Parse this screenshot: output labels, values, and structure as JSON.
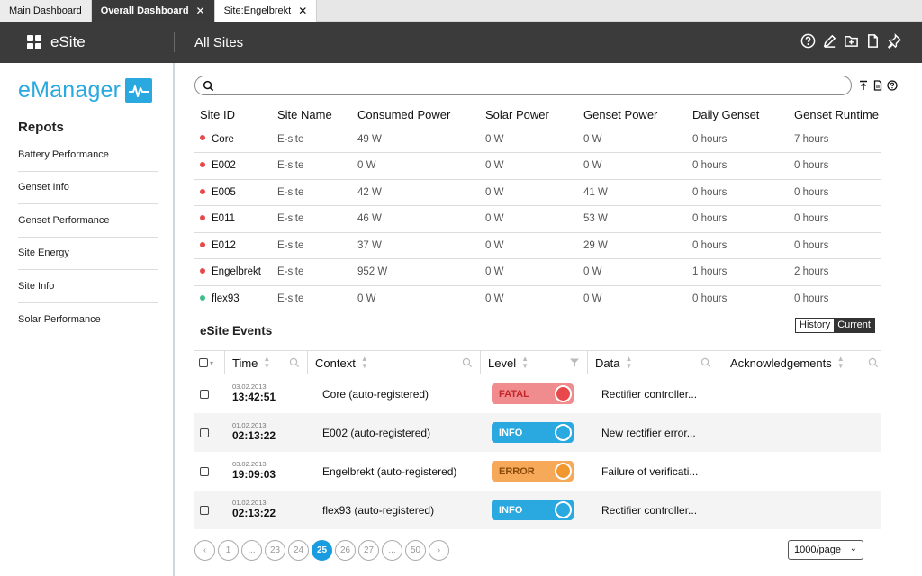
{
  "tabs": [
    {
      "label": "Main Dashboard",
      "active": false,
      "closable": false
    },
    {
      "label": "Overall Dashboard",
      "active": true,
      "closable": true
    },
    {
      "label": "Site:Engelbrekt",
      "active": false,
      "closable": true
    }
  ],
  "header": {
    "app_name": "eSite",
    "page_title": "All Sites",
    "actions": [
      "help-icon",
      "edit-icon",
      "add-folder-icon",
      "document-icon",
      "pin-icon"
    ]
  },
  "sidebar": {
    "logo_text": "eManager",
    "heading": "Repots",
    "items": [
      "Battery Performance",
      "Genset Info",
      "Genset Performance",
      "Site Energy",
      "Site Info",
      "Solar Performance"
    ]
  },
  "search": {
    "value": "",
    "placeholder": ""
  },
  "sites_table": {
    "columns": [
      "Site ID",
      "Site Name",
      "Consumed Power",
      "Solar Power",
      "Genset Power",
      "Daily Genset",
      "Genset Runtime"
    ],
    "rows": [
      {
        "status_color": "#e8474b",
        "cells": [
          "Core",
          "E-site",
          "49 W",
          "0 W",
          "0 W",
          "0 hours",
          "7 hours"
        ]
      },
      {
        "status_color": "#e8474b",
        "cells": [
          "E002",
          "E-site",
          "0 W",
          "0 W",
          "0 W",
          "0 hours",
          "0 hours"
        ]
      },
      {
        "status_color": "#e8474b",
        "cells": [
          "E005",
          "E-site",
          "42 W",
          "0 W",
          "41 W",
          "0 hours",
          "0 hours"
        ]
      },
      {
        "status_color": "#e8474b",
        "cells": [
          "E011",
          "E-site",
          "46 W",
          "0 W",
          "53 W",
          "0 hours",
          "0 hours"
        ]
      },
      {
        "status_color": "#e8474b",
        "cells": [
          "E012",
          "E-site",
          "37 W",
          "0 W",
          "29 W",
          "0 hours",
          "0 hours"
        ]
      },
      {
        "status_color": "#e8474b",
        "cells": [
          "Engelbrekt",
          "E-site",
          "952 W",
          "0 W",
          "0 W",
          "1 hours",
          "2 hours"
        ]
      },
      {
        "status_color": "#3fbf87",
        "cells": [
          "flex93",
          "E-site",
          "0 W",
          "0 W",
          "0 W",
          "0 hours",
          "0 hours"
        ]
      }
    ]
  },
  "events": {
    "title": "eSite Events",
    "view_toggle": {
      "options": [
        "History",
        "Current"
      ],
      "selected": "Current"
    },
    "columns": [
      "Time",
      "Context",
      "Level",
      "Data",
      "Acknowledgements"
    ],
    "rows": [
      {
        "date": "03.02.2013",
        "time": "13:42:51",
        "context": "Core (auto-registered)",
        "level": "FATAL",
        "level_bg": "#f08c8e",
        "level_text": "#c4262b",
        "knob": "#e8474b",
        "data": "Rectifier controller..."
      },
      {
        "date": "01.02.2013",
        "time": "02:13:22",
        "context": "E002 (auto-registered)",
        "level": "INFO",
        "level_bg": "#29a9e0",
        "level_text": "#ffffff",
        "knob": "#29a9e0",
        "data": "New rectifier error..."
      },
      {
        "date": "03.02.2013",
        "time": "19:09:03",
        "context": "Engelbrekt (auto-registered)",
        "level": "ERROR",
        "level_bg": "#f5a959",
        "level_text": "#8a4a0a",
        "knob": "#f0982f",
        "data": "Failure of verificati..."
      },
      {
        "date": "01.02.2013",
        "time": "02:13:22",
        "context": "flex93 (auto-registered)",
        "level": "INFO",
        "level_bg": "#29a9e0",
        "level_text": "#ffffff",
        "knob": "#29a9e0",
        "data": "Rectifier controller..."
      }
    ]
  },
  "pagination": {
    "pages": [
      "1",
      "...",
      "23",
      "24",
      "25",
      "26",
      "27",
      "...",
      "50"
    ],
    "current": "25",
    "per_page": "1000/page"
  }
}
